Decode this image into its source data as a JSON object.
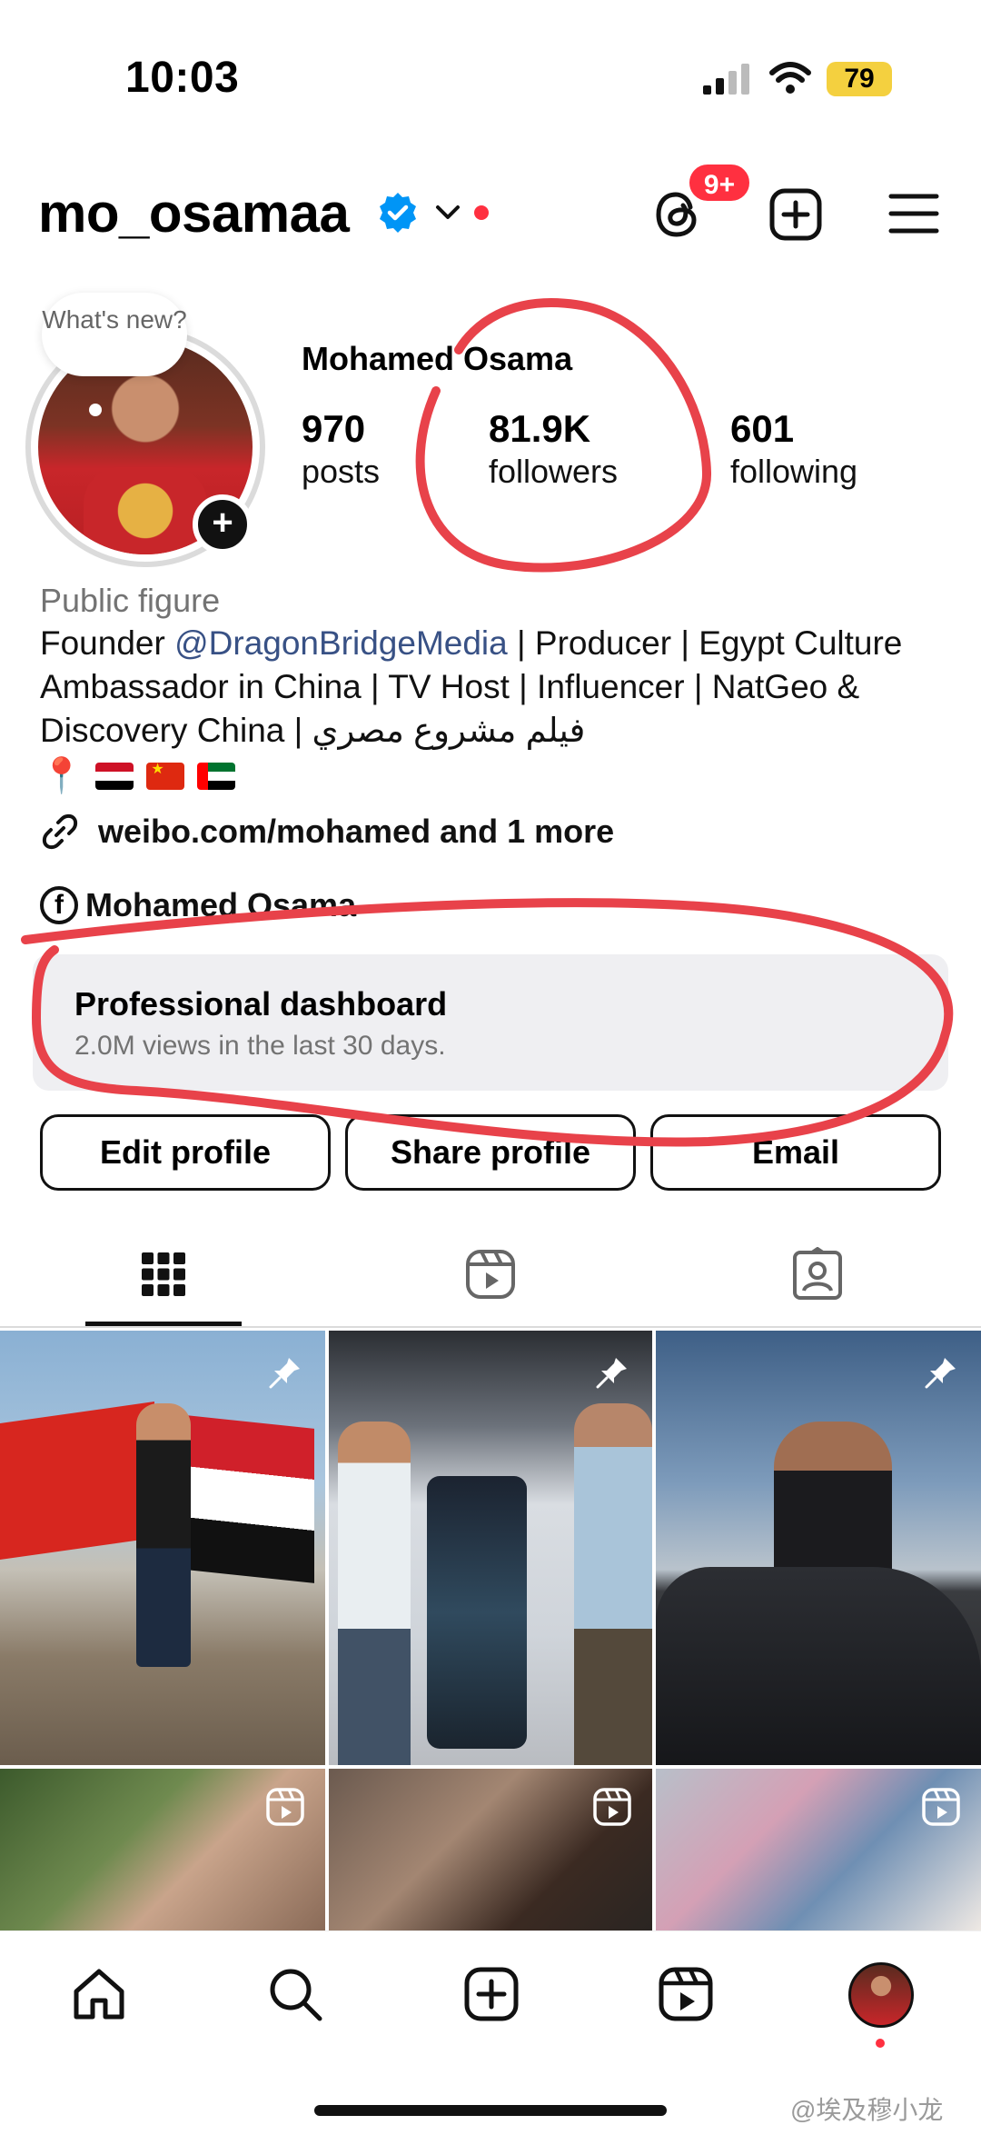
{
  "status_bar": {
    "time": "10:03",
    "battery": "79"
  },
  "header": {
    "username": "mo_osamaa",
    "threads_badge": "9+"
  },
  "profile": {
    "note_bubble": "What's new?",
    "full_name": "Mohamed Osama",
    "stats": [
      {
        "value": "970",
        "label": "posts"
      },
      {
        "value": "81.9K",
        "label": "followers"
      },
      {
        "value": "601",
        "label": "following"
      }
    ],
    "category": "Public figure",
    "bio_prefix": "Founder ",
    "bio_mention": "@DragonBridgeMedia",
    "bio_suffix": " | Producer | Egypt Culture Ambassador in China | TV Host | Influencer | NatGeo & Discovery China | فيلم مشروع مصري",
    "link_text": "weibo.com/mohamed and 1 more",
    "facebook_name": "Mohamed Osama"
  },
  "dashboard": {
    "title": "Professional dashboard",
    "subtitle": "2.0M views in the last 30 days."
  },
  "buttons": {
    "edit": "Edit profile",
    "share": "Share profile",
    "email": "Email"
  },
  "tabs": [
    "grid-icon",
    "reels-icon",
    "tagged-icon"
  ],
  "nav_icons": [
    "home-icon",
    "search-icon",
    "create-icon",
    "reels-icon",
    "profile-avatar"
  ],
  "watermark": "@埃及穆小龙",
  "colors": {
    "mention": "#385185",
    "badge": "#ff3040",
    "verified": "#0095f6",
    "annotation": "#e8424a"
  }
}
